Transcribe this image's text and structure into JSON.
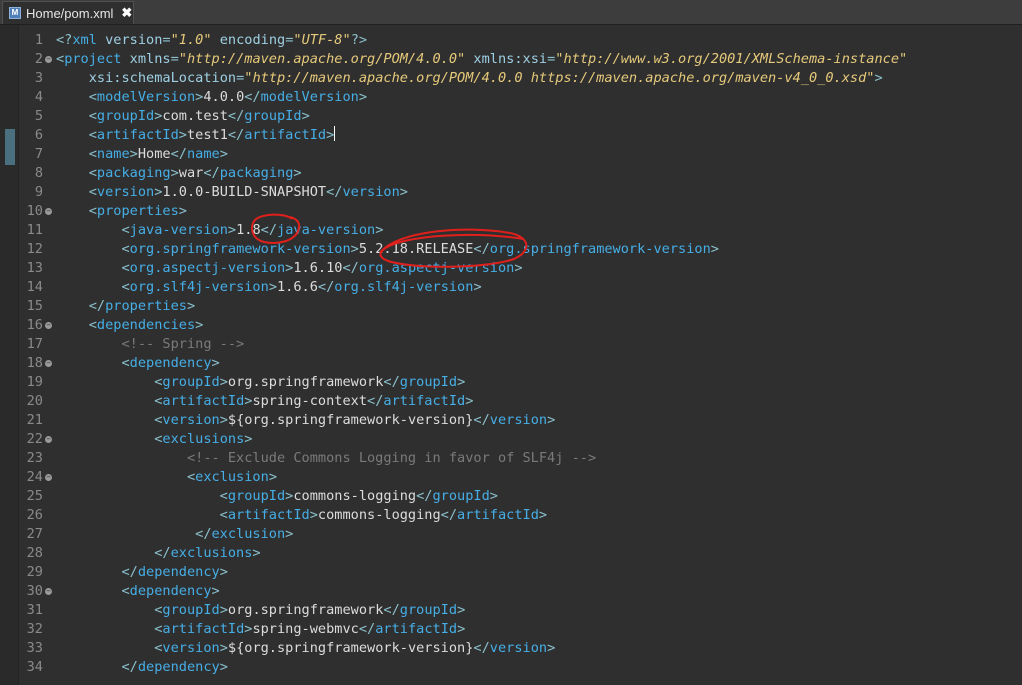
{
  "tab": {
    "title": "Home/pom.xml",
    "icon": "maven-file-icon",
    "close_label": "✖"
  },
  "lines": [
    {
      "n": "1",
      "fold": false,
      "t": [
        [
          "p",
          "<?"
        ],
        [
          "g",
          "xml "
        ],
        [
          "a",
          "version"
        ],
        [
          "p",
          "="
        ],
        [
          "v",
          "\"1.0\""
        ],
        [
          "p",
          " "
        ],
        [
          "a",
          "encoding"
        ],
        [
          "p",
          "="
        ],
        [
          "v",
          "\"UTF-8\""
        ],
        [
          "p",
          "?>"
        ]
      ]
    },
    {
      "n": "2",
      "fold": true,
      "t": [
        [
          "p",
          "<"
        ],
        [
          "g",
          "project "
        ],
        [
          "a",
          "xmlns"
        ],
        [
          "p",
          "="
        ],
        [
          "v",
          "\"http://maven.apache.org/POM/4.0.0\""
        ],
        [
          "p",
          " "
        ],
        [
          "a",
          "xmlns:xsi"
        ],
        [
          "p",
          "="
        ],
        [
          "v",
          "\"http://www.w3.org/2001/XMLSchema-instance\""
        ]
      ]
    },
    {
      "n": "3",
      "fold": false,
      "t": [
        [
          "p",
          "    "
        ],
        [
          "a",
          "xsi:schemaLocation"
        ],
        [
          "p",
          "="
        ],
        [
          "v",
          "\"http://maven.apache.org/POM/4.0.0 https://maven.apache.org/maven-v4_0_0.xsd\""
        ],
        [
          "p",
          ">"
        ]
      ]
    },
    {
      "n": "4",
      "fold": false,
      "t": [
        [
          "p",
          "    <"
        ],
        [
          "g",
          "modelVersion"
        ],
        [
          "p",
          ">"
        ],
        [
          "x",
          "4.0.0"
        ],
        [
          "p",
          "</"
        ],
        [
          "g",
          "modelVersion"
        ],
        [
          "p",
          ">"
        ]
      ]
    },
    {
      "n": "5",
      "fold": false,
      "t": [
        [
          "p",
          "    <"
        ],
        [
          "g",
          "groupId"
        ],
        [
          "p",
          ">"
        ],
        [
          "x",
          "com.test"
        ],
        [
          "p",
          "</"
        ],
        [
          "g",
          "groupId"
        ],
        [
          "p",
          ">"
        ]
      ]
    },
    {
      "n": "6",
      "fold": false,
      "t": [
        [
          "p",
          "    <"
        ],
        [
          "g",
          "artifactId"
        ],
        [
          "p",
          ">"
        ],
        [
          "x",
          "test1"
        ],
        [
          "p",
          "</"
        ],
        [
          "g",
          "artifactId"
        ],
        [
          "p",
          ">"
        ],
        [
          "caret",
          ""
        ]
      ]
    },
    {
      "n": "7",
      "fold": false,
      "t": [
        [
          "p",
          "    <"
        ],
        [
          "g",
          "name"
        ],
        [
          "p",
          ">"
        ],
        [
          "x",
          "Home"
        ],
        [
          "p",
          "</"
        ],
        [
          "g",
          "name"
        ],
        [
          "p",
          ">"
        ]
      ]
    },
    {
      "n": "8",
      "fold": false,
      "t": [
        [
          "p",
          "    <"
        ],
        [
          "g",
          "packaging"
        ],
        [
          "p",
          ">"
        ],
        [
          "x",
          "war"
        ],
        [
          "p",
          "</"
        ],
        [
          "g",
          "packaging"
        ],
        [
          "p",
          ">"
        ]
      ]
    },
    {
      "n": "9",
      "fold": false,
      "t": [
        [
          "p",
          "    <"
        ],
        [
          "g",
          "version"
        ],
        [
          "p",
          ">"
        ],
        [
          "x",
          "1.0.0-BUILD-SNAPSHOT"
        ],
        [
          "p",
          "</"
        ],
        [
          "g",
          "version"
        ],
        [
          "p",
          ">"
        ]
      ]
    },
    {
      "n": "10",
      "fold": true,
      "t": [
        [
          "p",
          "    <"
        ],
        [
          "g",
          "properties"
        ],
        [
          "p",
          ">"
        ]
      ]
    },
    {
      "n": "11",
      "fold": false,
      "t": [
        [
          "p",
          "        <"
        ],
        [
          "g",
          "java-version"
        ],
        [
          "p",
          ">"
        ],
        [
          "x",
          "1.8"
        ],
        [
          "p",
          "</"
        ],
        [
          "g",
          "java-version"
        ],
        [
          "p",
          ">"
        ]
      ]
    },
    {
      "n": "12",
      "fold": false,
      "t": [
        [
          "p",
          "        <"
        ],
        [
          "g",
          "org.springframework-version"
        ],
        [
          "p",
          ">"
        ],
        [
          "x",
          "5.2.18.RELEASE"
        ],
        [
          "p",
          "</"
        ],
        [
          "g",
          "org.springframework-version"
        ],
        [
          "p",
          ">"
        ]
      ]
    },
    {
      "n": "13",
      "fold": false,
      "t": [
        [
          "p",
          "        <"
        ],
        [
          "g",
          "org.aspectj-version"
        ],
        [
          "p",
          ">"
        ],
        [
          "x",
          "1.6.10"
        ],
        [
          "p",
          "</"
        ],
        [
          "g",
          "org.aspectj-version"
        ],
        [
          "p",
          ">"
        ]
      ]
    },
    {
      "n": "14",
      "fold": false,
      "t": [
        [
          "p",
          "        <"
        ],
        [
          "g",
          "org.slf4j-version"
        ],
        [
          "p",
          ">"
        ],
        [
          "x",
          "1.6.6"
        ],
        [
          "p",
          "</"
        ],
        [
          "g",
          "org.slf4j-version"
        ],
        [
          "p",
          ">"
        ]
      ]
    },
    {
      "n": "15",
      "fold": false,
      "t": [
        [
          "p",
          "    </"
        ],
        [
          "g",
          "properties"
        ],
        [
          "p",
          ">"
        ]
      ]
    },
    {
      "n": "16",
      "fold": true,
      "t": [
        [
          "p",
          "    <"
        ],
        [
          "g",
          "dependencies"
        ],
        [
          "p",
          ">"
        ]
      ]
    },
    {
      "n": "17",
      "fold": false,
      "t": [
        [
          "c",
          "        <!-- Spring -->"
        ]
      ]
    },
    {
      "n": "18",
      "fold": true,
      "t": [
        [
          "p",
          "        <"
        ],
        [
          "g",
          "dependency"
        ],
        [
          "p",
          ">"
        ]
      ]
    },
    {
      "n": "19",
      "fold": false,
      "t": [
        [
          "p",
          "            <"
        ],
        [
          "g",
          "groupId"
        ],
        [
          "p",
          ">"
        ],
        [
          "x",
          "org.springframework"
        ],
        [
          "p",
          "</"
        ],
        [
          "g",
          "groupId"
        ],
        [
          "p",
          ">"
        ]
      ]
    },
    {
      "n": "20",
      "fold": false,
      "t": [
        [
          "p",
          "            <"
        ],
        [
          "g",
          "artifactId"
        ],
        [
          "p",
          ">"
        ],
        [
          "x",
          "spring-context"
        ],
        [
          "p",
          "</"
        ],
        [
          "g",
          "artifactId"
        ],
        [
          "p",
          ">"
        ]
      ]
    },
    {
      "n": "21",
      "fold": false,
      "t": [
        [
          "p",
          "            <"
        ],
        [
          "g",
          "version"
        ],
        [
          "p",
          ">"
        ],
        [
          "x",
          "${org.springframework-version}"
        ],
        [
          "p",
          "</"
        ],
        [
          "g",
          "version"
        ],
        [
          "p",
          ">"
        ]
      ]
    },
    {
      "n": "22",
      "fold": true,
      "t": [
        [
          "p",
          "            <"
        ],
        [
          "g",
          "exclusions"
        ],
        [
          "p",
          ">"
        ]
      ]
    },
    {
      "n": "23",
      "fold": false,
      "t": [
        [
          "c",
          "                <!-- Exclude Commons Logging in favor of SLF4j -->"
        ]
      ]
    },
    {
      "n": "24",
      "fold": true,
      "t": [
        [
          "p",
          "                <"
        ],
        [
          "g",
          "exclusion"
        ],
        [
          "p",
          ">"
        ]
      ]
    },
    {
      "n": "25",
      "fold": false,
      "t": [
        [
          "p",
          "                    <"
        ],
        [
          "g",
          "groupId"
        ],
        [
          "p",
          ">"
        ],
        [
          "x",
          "commons-logging"
        ],
        [
          "p",
          "</"
        ],
        [
          "g",
          "groupId"
        ],
        [
          "p",
          ">"
        ]
      ]
    },
    {
      "n": "26",
      "fold": false,
      "t": [
        [
          "p",
          "                    <"
        ],
        [
          "g",
          "artifactId"
        ],
        [
          "p",
          ">"
        ],
        [
          "x",
          "commons-logging"
        ],
        [
          "p",
          "</"
        ],
        [
          "g",
          "artifactId"
        ],
        [
          "p",
          ">"
        ]
      ]
    },
    {
      "n": "27",
      "fold": false,
      "t": [
        [
          "p",
          "                 </"
        ],
        [
          "g",
          "exclusion"
        ],
        [
          "p",
          ">"
        ]
      ]
    },
    {
      "n": "28",
      "fold": false,
      "t": [
        [
          "p",
          "            </"
        ],
        [
          "g",
          "exclusions"
        ],
        [
          "p",
          ">"
        ]
      ]
    },
    {
      "n": "29",
      "fold": false,
      "t": [
        [
          "p",
          "        </"
        ],
        [
          "g",
          "dependency"
        ],
        [
          "p",
          ">"
        ]
      ]
    },
    {
      "n": "30",
      "fold": true,
      "t": [
        [
          "p",
          "        <"
        ],
        [
          "g",
          "dependency"
        ],
        [
          "p",
          ">"
        ]
      ]
    },
    {
      "n": "31",
      "fold": false,
      "t": [
        [
          "p",
          "            <"
        ],
        [
          "g",
          "groupId"
        ],
        [
          "p",
          ">"
        ],
        [
          "x",
          "org.springframework"
        ],
        [
          "p",
          "</"
        ],
        [
          "g",
          "groupId"
        ],
        [
          "p",
          ">"
        ]
      ]
    },
    {
      "n": "32",
      "fold": false,
      "t": [
        [
          "p",
          "            <"
        ],
        [
          "g",
          "artifactId"
        ],
        [
          "p",
          ">"
        ],
        [
          "x",
          "spring-webmvc"
        ],
        [
          "p",
          "</"
        ],
        [
          "g",
          "artifactId"
        ],
        [
          "p",
          ">"
        ]
      ]
    },
    {
      "n": "33",
      "fold": false,
      "t": [
        [
          "p",
          "            <"
        ],
        [
          "g",
          "version"
        ],
        [
          "p",
          ">"
        ],
        [
          "x",
          "${org.springframework-version}"
        ],
        [
          "p",
          "</"
        ],
        [
          "g",
          "version"
        ],
        [
          "p",
          ">"
        ]
      ]
    },
    {
      "n": "34",
      "fold": false,
      "t": [
        [
          "p",
          "        </"
        ],
        [
          "g",
          "dependency"
        ],
        [
          "p",
          ">"
        ]
      ]
    }
  ],
  "colors": {
    "tag": "#46aee6",
    "attribute": "#9ecfe3",
    "value": "#e6c97a",
    "text": "#dcdcdc",
    "comment": "#7a7a7a",
    "annotation": "#e0201c"
  }
}
